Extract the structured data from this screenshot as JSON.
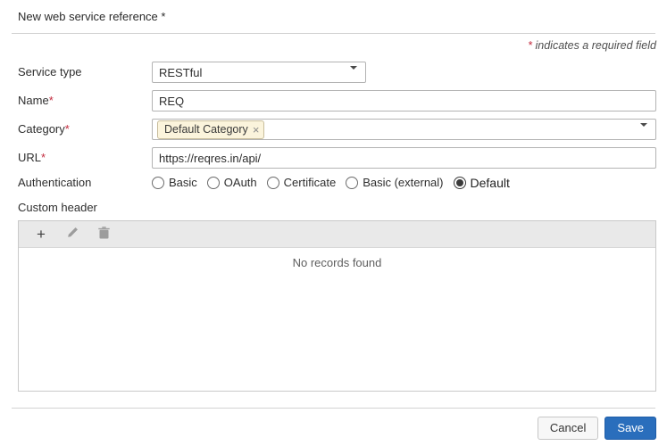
{
  "header": {
    "title": "New web service reference *",
    "required_note_star": "*",
    "required_note_text": " indicates a required field"
  },
  "form": {
    "service_type": {
      "label": "Service type",
      "value": "RESTful"
    },
    "name": {
      "label": "Name",
      "required_mark": "*",
      "value": "REQ"
    },
    "category": {
      "label": "Category",
      "required_mark": "*",
      "chip_label": "Default Category",
      "chip_remove": "×"
    },
    "url": {
      "label": "URL",
      "required_mark": "*",
      "value": "https://reqres.in/api/"
    },
    "authentication": {
      "label": "Authentication",
      "options": [
        {
          "label": "Basic",
          "selected": false
        },
        {
          "label": "OAuth",
          "selected": false
        },
        {
          "label": "Certificate",
          "selected": false
        },
        {
          "label": "Basic (external)",
          "selected": false
        },
        {
          "label": "Default",
          "selected": true
        }
      ]
    },
    "custom_header": {
      "label": "Custom header",
      "toolbar": {
        "add_glyph": "+",
        "tools": [
          "add",
          "edit",
          "delete"
        ]
      },
      "empty_text": "No records found"
    }
  },
  "footer": {
    "cancel_label": "Cancel",
    "save_label": "Save"
  },
  "colors": {
    "save_button": "#2a6ebc",
    "required_mark": "#c32b3e",
    "chip_background": "#fbf4dc",
    "chip_border": "#c8bd9c",
    "toolbar_background": "#e9e9e9"
  }
}
